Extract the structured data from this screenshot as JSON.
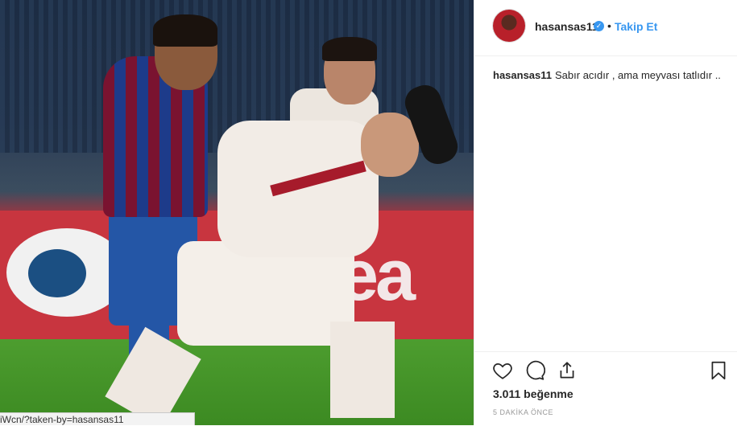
{
  "post": {
    "username": "hasansas11",
    "verified_badge": "verified-icon",
    "separator": "•",
    "follow_label": "Takip Et",
    "caption_user": "hasansas11",
    "caption_text": "Sabır acıdır , ama meyvası tatlıdır ..",
    "likes": "3.011 beğenme",
    "time": "5 DAKİKA ÖNCE"
  },
  "photo": {
    "banner_text": "ea"
  },
  "status_url": "iWcn/?taken-by=hasansas11",
  "icons": [
    "heart-icon",
    "comment-icon",
    "share-icon",
    "bookmark-icon"
  ],
  "colors": {
    "accent": "#3897f0",
    "text": "#262626",
    "muted": "#999999"
  }
}
